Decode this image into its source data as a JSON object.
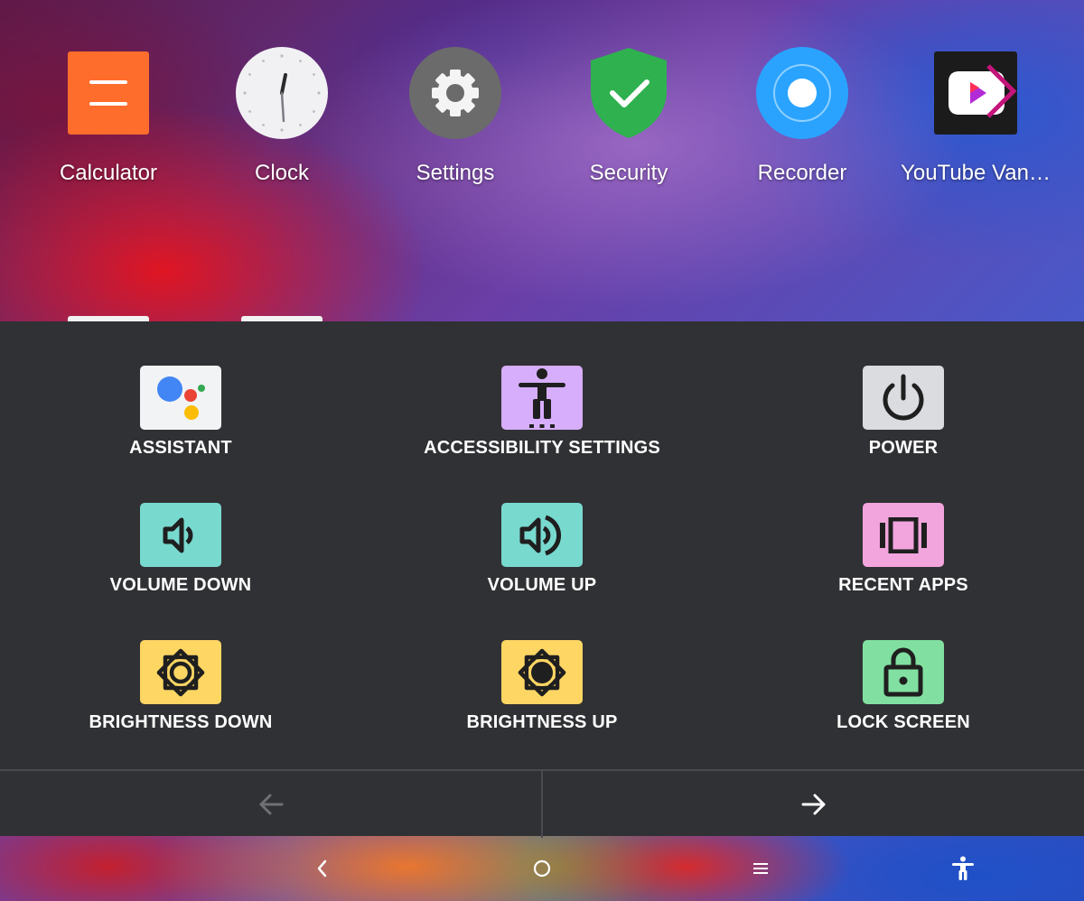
{
  "home": {
    "apps": [
      {
        "label": "Calculator",
        "icon": "calculator-icon",
        "color": "#ff6d2c"
      },
      {
        "label": "Clock",
        "icon": "clock-icon",
        "color": "#f1f1f4"
      },
      {
        "label": "Settings",
        "icon": "settings-gear-icon",
        "color": "#6b6b6b"
      },
      {
        "label": "Security",
        "icon": "security-shield-icon",
        "color": "#2fb14f"
      },
      {
        "label": "Recorder",
        "icon": "recorder-icon",
        "color": "#2aa3ff"
      },
      {
        "label": "YouTube Van…",
        "icon": "youtube-vanced-icon",
        "color": "#1b1b1b"
      }
    ]
  },
  "menu": {
    "items": [
      {
        "label": "ASSISTANT",
        "icon": "assistant-icon",
        "color": "#f1f3f4"
      },
      {
        "label": "ACCESSIBILITY SETTINGS",
        "icon": "accessibility-person-icon",
        "color": "#d7aefb"
      },
      {
        "label": "POWER",
        "icon": "power-icon",
        "color": "#dadce0"
      },
      {
        "label": "VOLUME DOWN",
        "icon": "volume-down-icon",
        "color": "#78d9cf"
      },
      {
        "label": "VOLUME UP",
        "icon": "volume-up-icon",
        "color": "#78d9cf"
      },
      {
        "label": "RECENT APPS",
        "icon": "recent-apps-icon",
        "color": "#f2a4dc"
      },
      {
        "label": "BRIGHTNESS DOWN",
        "icon": "brightness-down-icon",
        "color": "#fdd663"
      },
      {
        "label": "BRIGHTNESS UP",
        "icon": "brightness-up-icon",
        "color": "#fdd663"
      },
      {
        "label": "LOCK SCREEN",
        "icon": "lock-icon",
        "color": "#81e0a1"
      }
    ],
    "pager": {
      "previous_icon": "arrow-left-icon",
      "next_icon": "arrow-right-icon"
    }
  },
  "navbar": {
    "back_icon": "back-chevron-icon",
    "home_icon": "home-circle-icon",
    "recents_icon": "menu-lines-icon",
    "accessibility_icon": "accessibility-icon"
  }
}
